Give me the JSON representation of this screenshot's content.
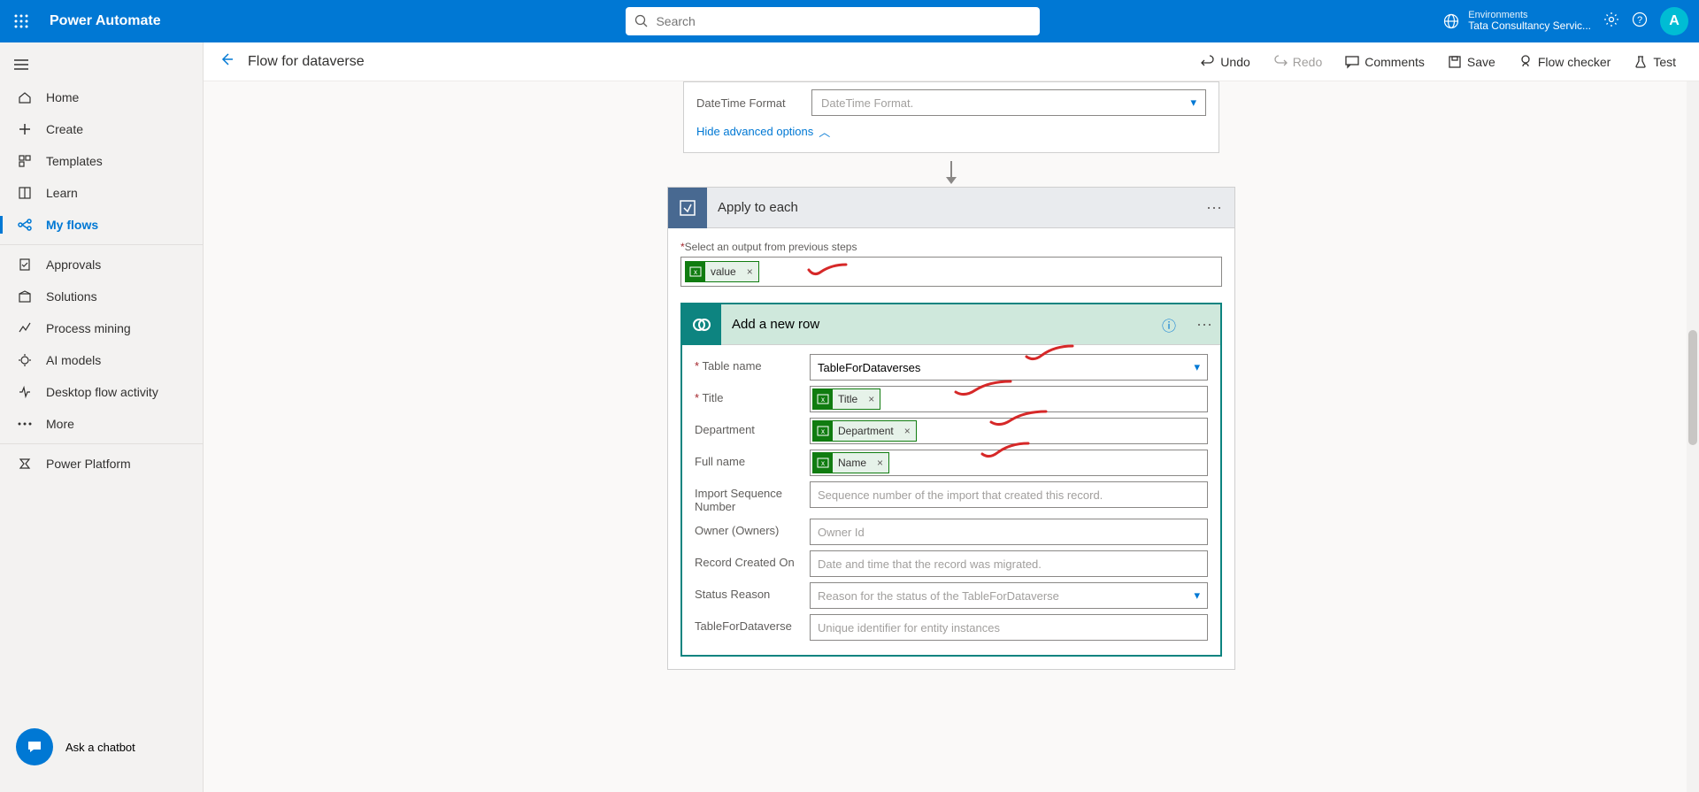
{
  "top": {
    "app_name": "Power Automate",
    "search_placeholder": "Search",
    "env_label": "Environments",
    "env_value": "Tata Consultancy Servic...",
    "avatar_letter": "A"
  },
  "sidebar": {
    "items": [
      {
        "label": "Home"
      },
      {
        "label": "Create"
      },
      {
        "label": "Templates"
      },
      {
        "label": "Learn"
      },
      {
        "label": "My flows"
      },
      {
        "label": "Approvals"
      },
      {
        "label": "Solutions"
      },
      {
        "label": "Process mining"
      },
      {
        "label": "AI models"
      },
      {
        "label": "Desktop flow activity"
      },
      {
        "label": "More"
      },
      {
        "label": "Power Platform"
      }
    ],
    "chatbot_label": "Ask a chatbot"
  },
  "toolbar": {
    "title": "Flow for dataverse",
    "undo": "Undo",
    "redo": "Redo",
    "comments": "Comments",
    "save": "Save",
    "flow_checker": "Flow checker",
    "test": "Test"
  },
  "topcard": {
    "dt_label": "DateTime Format",
    "dt_placeholder": "DateTime Format.",
    "adv_link": "Hide advanced options"
  },
  "apply": {
    "title": "Apply to each",
    "select_output": "Select an output from previous steps",
    "value_token": "value"
  },
  "addrow": {
    "title": "Add a new row",
    "table_lbl": "Table name",
    "table_val": "TableForDataverses",
    "title_lbl": "Title",
    "title_token": "Title",
    "dept_lbl": "Department",
    "dept_token": "Department",
    "fullname_lbl": "Full name",
    "fullname_token": "Name",
    "impseq_lbl": "Import Sequence Number",
    "impseq_ph": "Sequence number of the import that created this record.",
    "owner_lbl": "Owner (Owners)",
    "owner_ph": "Owner Id",
    "created_lbl": "Record Created On",
    "created_ph": "Date and time that the record was migrated.",
    "status_lbl": "Status Reason",
    "status_ph": "Reason for the status of the TableForDataverse",
    "tfd_lbl": "TableForDataverse",
    "tfd_ph": "Unique identifier for entity instances"
  }
}
